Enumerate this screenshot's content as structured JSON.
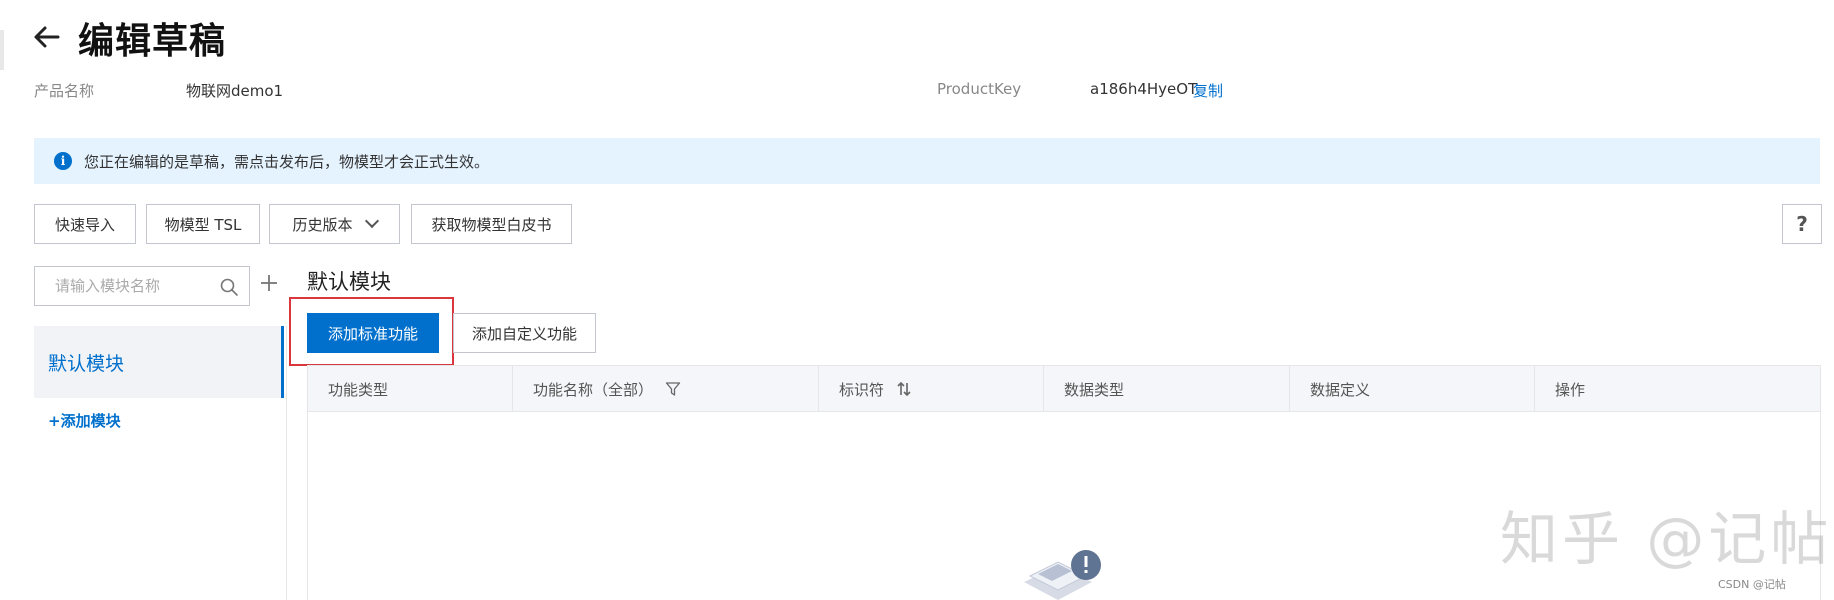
{
  "header": {
    "title": "编辑草稿",
    "product_name_label": "产品名称",
    "product_name_value": "物联网demo1",
    "product_key_label": "ProductKey",
    "product_key_value": "a186h4HyeOT",
    "copy_label": "复制"
  },
  "notice": {
    "text": "您正在编辑的是草稿，需点击发布后，物模型才会正式生效。"
  },
  "toolbar": {
    "quick_import": "快速导入",
    "tsl": "物模型 TSL",
    "history": "历史版本",
    "whitepaper": "获取物模型白皮书",
    "help": "?"
  },
  "sidebar": {
    "search_placeholder": "请输入模块名称",
    "modules": [
      {
        "label": "默认模块",
        "active": true
      }
    ],
    "add_module": "+添加模块"
  },
  "main": {
    "section_title": "默认模块",
    "add_standard": "添加标准功能",
    "add_custom": "添加自定义功能",
    "columns": [
      "功能类型",
      "功能名称（全部）",
      "标识符",
      "数据类型",
      "数据定义",
      "操作"
    ]
  },
  "watermark": {
    "zhihu": "知乎 @记帖",
    "csdn": "CSDN @记帖"
  },
  "colors": {
    "primary": "#0070cc",
    "notice_bg": "#e5f3ff",
    "highlight": "#d9363e"
  }
}
